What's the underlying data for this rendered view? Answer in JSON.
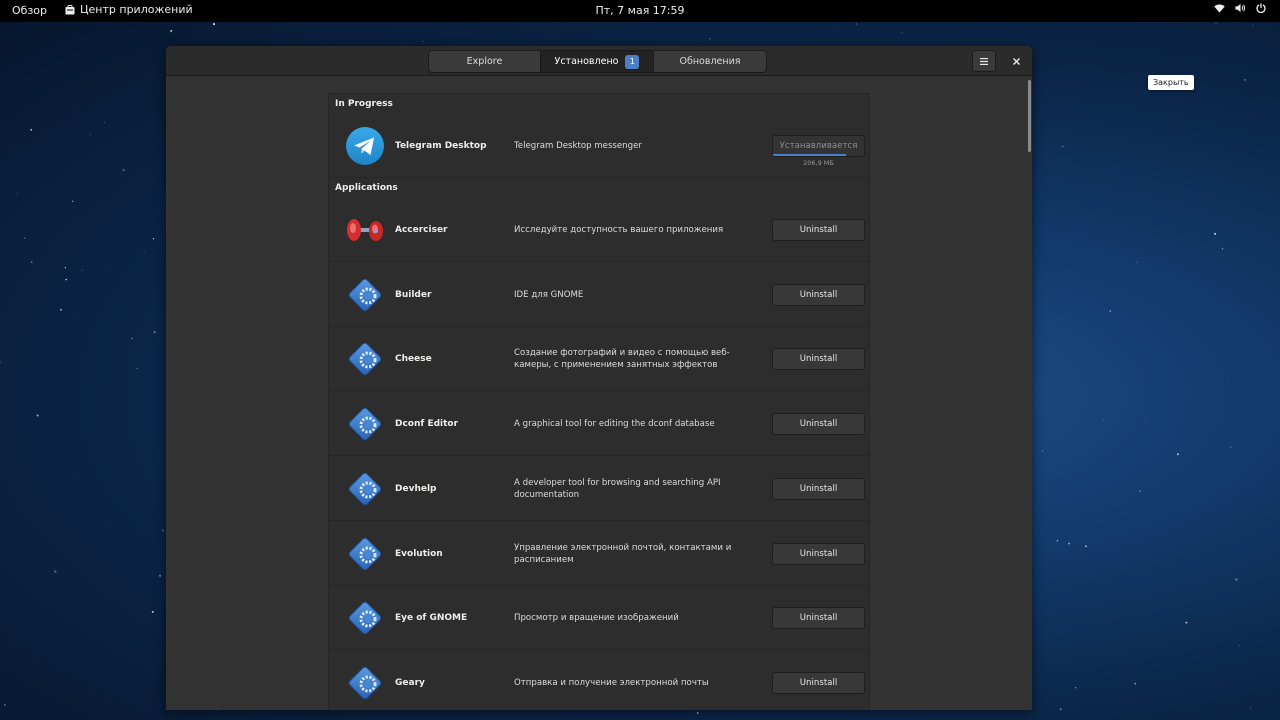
{
  "topbar": {
    "activities": "Обзор",
    "app_name": "Центр приложений",
    "clock": "Пт, 7 мая  17:59",
    "status_icons": [
      "wifi-icon",
      "volume-icon",
      "power-icon"
    ]
  },
  "headerbar": {
    "tabs": [
      {
        "label": "Explore"
      },
      {
        "label": "Установлено",
        "badge": "1"
      },
      {
        "label": "Обновления"
      }
    ],
    "menu_icon": "hamburger-icon",
    "close_icon": "close-icon"
  },
  "tooltip": "Закрыть",
  "in_progress": {
    "title": "In Progress",
    "item": {
      "name": "Telegram Desktop",
      "description": "Telegram Desktop messenger",
      "action": "Устанавливается",
      "size": "206,9 МБ",
      "progress": 0.8,
      "icon": "telegram-icon"
    }
  },
  "applications": {
    "title": "Applications",
    "items": [
      {
        "name": "Accerciser",
        "description": "Исследуйте доступность вашего приложения",
        "action": "Uninstall",
        "icon": "accerciser-icon"
      },
      {
        "name": "Builder",
        "description": "IDE для GNOME",
        "action": "Uninstall",
        "icon": "app-gear-icon"
      },
      {
        "name": "Cheese",
        "description": "Создание фотографий и видео с помощью веб-камеры, с применением занятных эффектов",
        "action": "Uninstall",
        "icon": "app-gear-icon"
      },
      {
        "name": "Dconf Editor",
        "description": "A graphical tool for editing the dconf database",
        "action": "Uninstall",
        "icon": "app-gear-icon"
      },
      {
        "name": "Devhelp",
        "description": "A developer tool for browsing and searching API documentation",
        "action": "Uninstall",
        "icon": "app-gear-icon"
      },
      {
        "name": "Evolution",
        "description": "Управление электронной почтой, контактами и расписанием",
        "action": "Uninstall",
        "icon": "app-gear-icon"
      },
      {
        "name": "Eye of GNOME",
        "description": "Просмотр и вращение изображений",
        "action": "Uninstall",
        "icon": "app-gear-icon"
      },
      {
        "name": "Geary",
        "description": "Отправка и получение электронной почты",
        "action": "Uninstall",
        "icon": "app-gear-icon"
      }
    ]
  },
  "colors": {
    "accent": "#4a80c6",
    "window_bg": "#353535",
    "headerbar_bg": "#2b2b2b",
    "list_bg": "#2d2d2d"
  }
}
